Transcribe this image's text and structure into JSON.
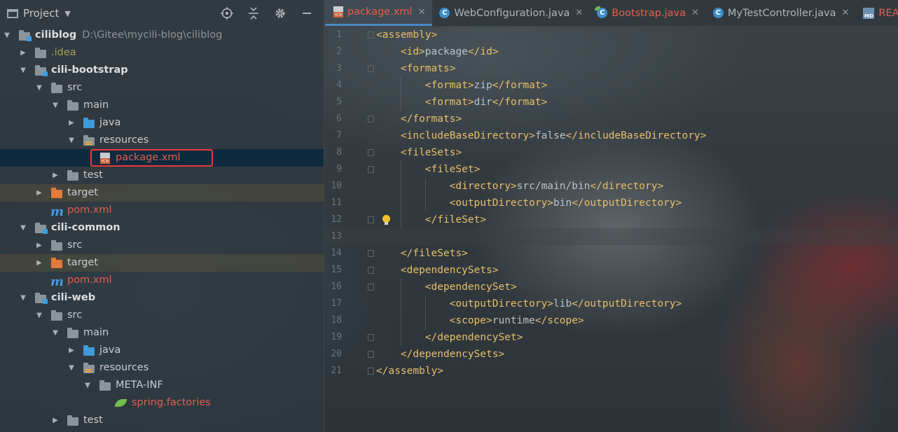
{
  "project_panel": {
    "title": "Project",
    "tree": [
      {
        "label": "ciliblog",
        "path": "D:\\Gitee\\mycili-blog\\ciliblog",
        "level": 0,
        "arrow": "down",
        "icon": "module-folder",
        "style": "bold"
      },
      {
        "label": ".idea",
        "level": 1,
        "arrow": "right",
        "icon": "folder",
        "style": "olive"
      },
      {
        "label": "cili-bootstrap",
        "level": 1,
        "arrow": "down",
        "icon": "module-folder",
        "style": "bold"
      },
      {
        "label": "src",
        "level": 2,
        "arrow": "down",
        "icon": "folder"
      },
      {
        "label": "main",
        "level": 3,
        "arrow": "down",
        "icon": "folder"
      },
      {
        "label": "java",
        "level": 4,
        "arrow": "right",
        "icon": "source-folder"
      },
      {
        "label": "resources",
        "level": 4,
        "arrow": "down",
        "icon": "resources-folder"
      },
      {
        "label": "package.xml",
        "level": 5,
        "arrow": "none",
        "icon": "xml-file",
        "style": "red",
        "selected": true
      },
      {
        "label": "test",
        "level": 3,
        "arrow": "right",
        "icon": "folder"
      },
      {
        "label": "target",
        "level": 2,
        "arrow": "right",
        "icon": "excluded-folder",
        "tinted": true
      },
      {
        "label": "pom.xml",
        "level": 2,
        "arrow": "none",
        "icon": "maven-file",
        "style": "red"
      },
      {
        "label": "cili-common",
        "level": 1,
        "arrow": "down",
        "icon": "module-folder",
        "style": "bold"
      },
      {
        "label": "src",
        "level": 2,
        "arrow": "right",
        "icon": "folder"
      },
      {
        "label": "target",
        "level": 2,
        "arrow": "right",
        "icon": "excluded-folder",
        "tinted": true
      },
      {
        "label": "pom.xml",
        "level": 2,
        "arrow": "none",
        "icon": "maven-file",
        "style": "red"
      },
      {
        "label": "cili-web",
        "level": 1,
        "arrow": "down",
        "icon": "module-folder",
        "style": "bold"
      },
      {
        "label": "src",
        "level": 2,
        "arrow": "down",
        "icon": "folder"
      },
      {
        "label": "main",
        "level": 3,
        "arrow": "down",
        "icon": "folder"
      },
      {
        "label": "java",
        "level": 4,
        "arrow": "right",
        "icon": "source-folder"
      },
      {
        "label": "resources",
        "level": 4,
        "arrow": "down",
        "icon": "resources-folder"
      },
      {
        "label": "META-INF",
        "level": 5,
        "arrow": "down",
        "icon": "folder"
      },
      {
        "label": "spring.factories",
        "level": 6,
        "arrow": "none",
        "icon": "spring-leaf-icon",
        "style": "red"
      },
      {
        "label": "test",
        "level": 3,
        "arrow": "right",
        "icon": "folder"
      }
    ]
  },
  "editor": {
    "tabs": [
      {
        "label": "package.xml",
        "icon": "xml-file",
        "active": true,
        "style": "red",
        "closable": true
      },
      {
        "label": "WebConfiguration.java",
        "icon": "class",
        "closable": true
      },
      {
        "label": "Bootstrap.java",
        "icon": "spring-boot-class",
        "style": "red",
        "closable": true
      },
      {
        "label": "MyTestController.java",
        "icon": "class",
        "closable": true
      },
      {
        "label": "README",
        "icon": "markdown",
        "style": "red",
        "closable": false
      }
    ],
    "lines": [
      {
        "n": "1",
        "indent": 0,
        "open": "assembly",
        "text": "",
        "close": "",
        "fold": true
      },
      {
        "n": "2",
        "indent": 1,
        "open": "id",
        "text": "package",
        "close": "id"
      },
      {
        "n": "3",
        "indent": 1,
        "open": "formats",
        "text": "",
        "close": "",
        "fold": true
      },
      {
        "n": "4",
        "indent": 2,
        "open": "format",
        "text": "zip",
        "close": "format"
      },
      {
        "n": "5",
        "indent": 2,
        "open": "format",
        "text": "dir",
        "close": "format"
      },
      {
        "n": "6",
        "indent": 1,
        "open": "",
        "text": "",
        "close": "formats",
        "fold": true
      },
      {
        "n": "7",
        "indent": 1,
        "open": "includeBaseDirectory",
        "text": "false",
        "close": "includeBaseDirectory"
      },
      {
        "n": "8",
        "indent": 1,
        "open": "fileSets",
        "text": "",
        "close": "",
        "fold": true
      },
      {
        "n": "9",
        "indent": 2,
        "open": "fileSet",
        "text": "",
        "close": "",
        "fold": true
      },
      {
        "n": "10",
        "indent": 3,
        "open": "directory",
        "text": "src/main/bin",
        "close": "directory"
      },
      {
        "n": "11",
        "indent": 3,
        "open": "outputDirectory",
        "text": "bin",
        "close": "outputDirectory"
      },
      {
        "n": "12",
        "indent": 2,
        "open": "",
        "text": "",
        "close": "fileSet",
        "fold": true,
        "bulb": true
      },
      {
        "n": "13",
        "indent": 0,
        "open": "",
        "text": "",
        "close": "",
        "current": true
      },
      {
        "n": "14",
        "indent": 1,
        "open": "",
        "text": "",
        "close": "fileSets",
        "fold": true
      },
      {
        "n": "15",
        "indent": 1,
        "open": "dependencySets",
        "text": "",
        "close": "",
        "fold": true
      },
      {
        "n": "16",
        "indent": 2,
        "open": "dependencySet",
        "text": "",
        "close": "",
        "fold": true
      },
      {
        "n": "17",
        "indent": 3,
        "open": "outputDirectory",
        "text": "lib",
        "close": "outputDirectory"
      },
      {
        "n": "18",
        "indent": 3,
        "open": "scope",
        "text": "runtime",
        "close": "scope"
      },
      {
        "n": "19",
        "indent": 2,
        "open": "",
        "text": "",
        "close": "dependencySet",
        "fold": true
      },
      {
        "n": "20",
        "indent": 1,
        "open": "",
        "text": "",
        "close": "dependencySets",
        "fold": true
      },
      {
        "n": "21",
        "indent": 0,
        "open": "",
        "text": "",
        "close": "assembly",
        "fold": true
      }
    ]
  },
  "colors": {
    "tag": "#e8bf6a",
    "selection": "#0d293e",
    "highlight_box": "#e8393c",
    "vcs_modified_red": "#e0604f"
  }
}
